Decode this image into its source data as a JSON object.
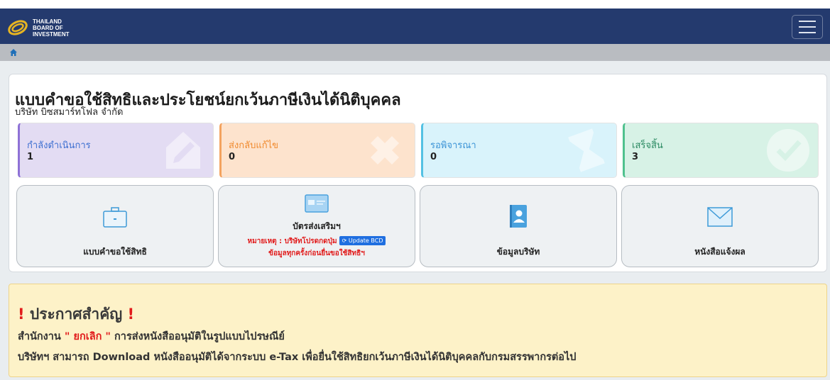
{
  "header": {
    "logo_text": [
      "THAILAND",
      "BOARD OF",
      "INVESTMENT"
    ],
    "menu_icon": "hamburger-icon"
  },
  "breadcrumb": {
    "icon": "home-icon"
  },
  "main": {
    "title": "แบบคำขอใช้สิทธิและประโยชน์ยกเว้นภาษีเงินได้นิติบุคคล",
    "company": "บริษัท บิซสมาร์ทโฟล จำกัด"
  },
  "stats": [
    {
      "label": "กำลังดำเนินการ",
      "count": "1",
      "icon": "edit-icon",
      "color": "#8e72d6"
    },
    {
      "label": "ส่งกลับแก้ไข",
      "count": "0",
      "icon": "cross-icon",
      "color": "#f3a35f"
    },
    {
      "label": "รอพิจารณา",
      "count": "0",
      "icon": "hourglass-icon",
      "color": "#53c1e3"
    },
    {
      "label": "เสร็จสิ้น",
      "count": "3",
      "icon": "check-circle-icon",
      "color": "#4fc18e"
    }
  ],
  "menu": [
    {
      "label": "แบบคำขอใช้สิทธิ",
      "icon": "briefcase-icon"
    },
    {
      "label": "บัตรส่งเสริมฯ",
      "icon": "card-icon",
      "note_prefix": "หมายเหตุ : บริษัทโปรดกดปุ่ม",
      "update_button": "Update BCD",
      "note_suffix": "ข้อมูลทุกครั้งก่อนยื่นขอใช้สิทธิฯ"
    },
    {
      "label": "ข้อมูลบริษัท",
      "icon": "contact-icon"
    },
    {
      "label": "หนังสือแจ้งผล",
      "icon": "envelope-icon"
    }
  ],
  "notice": {
    "bang": "!",
    "title": " ประกาศสำคัญ ",
    "line1_prefix": "สำนักงาน ",
    "line1_highlight": "\" ยกเลิก \"",
    "line1_suffix": " การส่งหนังสืออนุมัติในรูปแบบไปรษณีย์",
    "line2": "บริษัทฯ สามารถ Download หนังสืออนุมัติได้จากระบบ e-Tax เพื่อยื่นใช้สิทธิยกเว้นภาษีเงินได้นิติบุคคลกับกรมสรรพากรต่อไป"
  }
}
